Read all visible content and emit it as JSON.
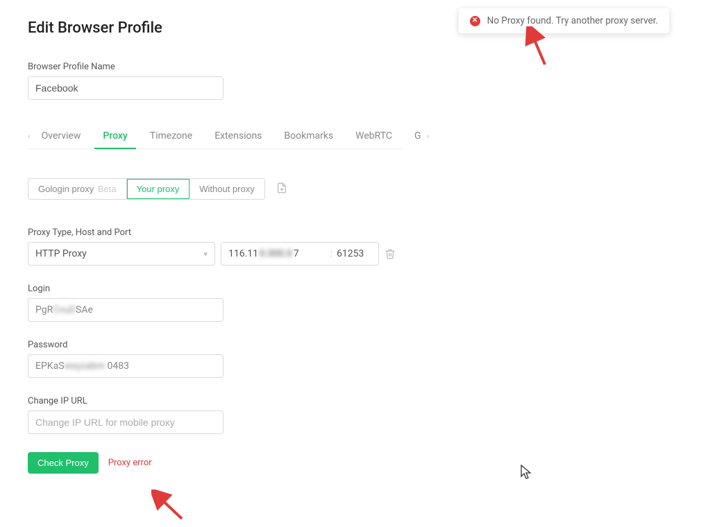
{
  "page": {
    "title": "Edit Browser Profile"
  },
  "profile_name": {
    "label": "Browser Profile Name",
    "value": "Facebook"
  },
  "tabs": {
    "items": [
      {
        "label": "Overview",
        "active": false
      },
      {
        "label": "Proxy",
        "active": true
      },
      {
        "label": "Timezone",
        "active": false
      },
      {
        "label": "Extensions",
        "active": false
      },
      {
        "label": "Bookmarks",
        "active": false
      },
      {
        "label": "WebRTC",
        "active": false
      },
      {
        "label": "G",
        "active": false
      }
    ]
  },
  "proxy_source": {
    "options": [
      {
        "label": "Gologin proxy",
        "badge": "Beta",
        "active": false
      },
      {
        "label": "Your proxy",
        "active": true
      },
      {
        "label": "Without proxy",
        "active": false
      }
    ]
  },
  "proxy_details": {
    "section_label": "Proxy Type, Host and Port",
    "type_select": {
      "value": "HTTP Proxy"
    },
    "host_visible_prefix": "116.11",
    "host_visible_suffix": "7",
    "port": "61253"
  },
  "login": {
    "label": "Login",
    "value_prefix": "PgR",
    "value_hidden": "CvuD",
    "value_suffix": "SAe"
  },
  "password": {
    "label": "Password",
    "value_prefix": "EPKaS",
    "value_suffix": "0483"
  },
  "change_ip": {
    "label": "Change IP URL",
    "placeholder": "Change IP URL for mobile proxy",
    "value": ""
  },
  "check": {
    "button_label": "Check Proxy",
    "error_text": "Proxy error"
  },
  "toast": {
    "message": "No Proxy found. Try another proxy server."
  }
}
